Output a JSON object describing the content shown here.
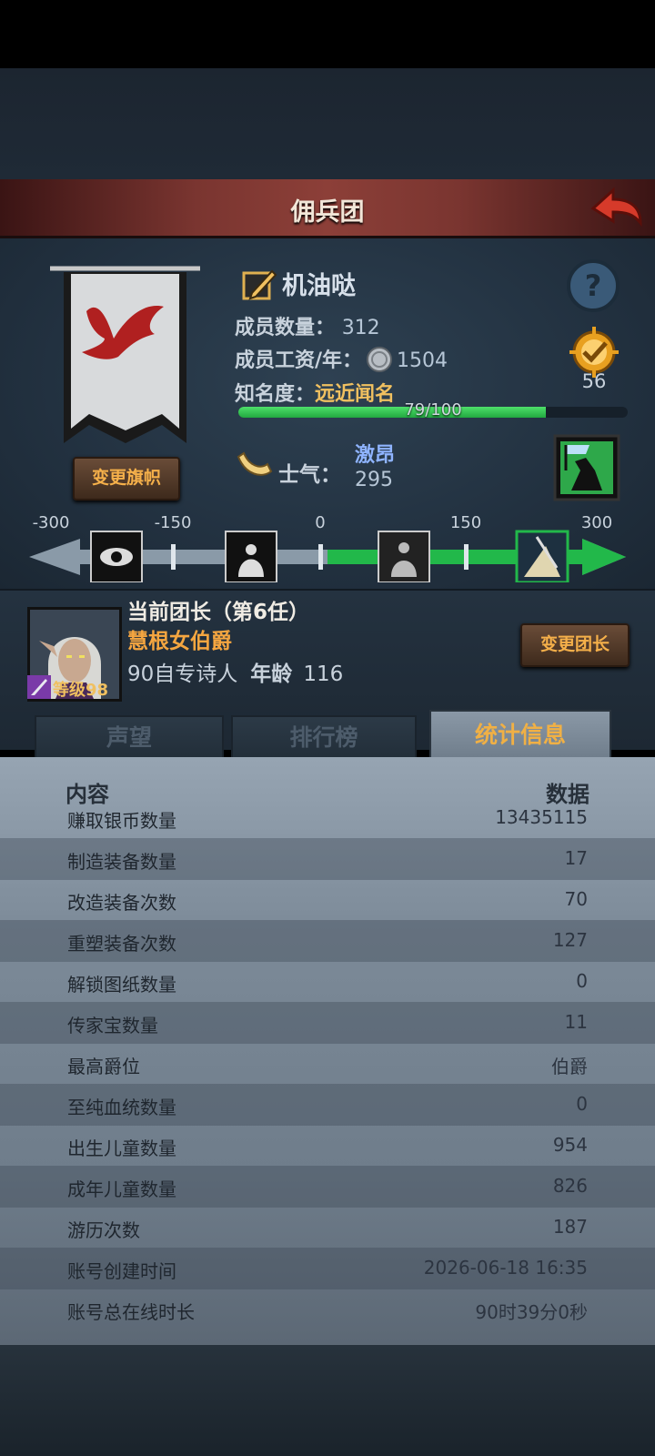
{
  "title": "佣兵团",
  "guild": {
    "name": "机油哒",
    "member_count_label": "成员数量：",
    "member_count": "312",
    "salary_label": "成员工资/年：",
    "salary": "1504",
    "fame_label": "知名度：",
    "fame_level": "远近闻名",
    "fame_progress_text": "79/100",
    "fame_progress": 0.79,
    "medal_count": "56",
    "change_flag_label": "变更旗帜"
  },
  "morale": {
    "label": "士气：",
    "state": "激昂",
    "value": "295",
    "scale_ticks": [
      "-300",
      "-150",
      "0",
      "150",
      "300"
    ]
  },
  "leader": {
    "title": "当前团长（第6任）",
    "name": "慧根女伯爵",
    "level_label": "等级98",
    "class_text": "90自专诗人",
    "age_label": "年龄",
    "age": "116",
    "change_leader_label": "变更团长"
  },
  "tabs": [
    "声望",
    "排行榜",
    "统计信息"
  ],
  "active_tab": "统计信息",
  "stats": {
    "header_left": "内容",
    "header_right": "数据",
    "rows": [
      {
        "k": "赚取银币数量",
        "v": "13435115"
      },
      {
        "k": "制造装备数量",
        "v": "17"
      },
      {
        "k": "改造装备次数",
        "v": "70"
      },
      {
        "k": "重塑装备次数",
        "v": "127"
      },
      {
        "k": "解锁图纸数量",
        "v": "0"
      },
      {
        "k": "传家宝数量",
        "v": "11"
      },
      {
        "k": "最高爵位",
        "v": "伯爵"
      },
      {
        "k": "至纯血统数量",
        "v": "0"
      },
      {
        "k": "出生儿童数量",
        "v": "954"
      },
      {
        "k": "成年儿童数量",
        "v": "826"
      },
      {
        "k": "游历次数",
        "v": "187"
      },
      {
        "k": "账号创建时间",
        "v": "2026-06-18 16:35"
      },
      {
        "k": "账号总在线时长",
        "v": "90时39分0秒"
      }
    ]
  },
  "colors": {
    "accent_orange": "#f5b04a",
    "morale_green": "#22b84a",
    "title_red": "#8c3f38"
  }
}
